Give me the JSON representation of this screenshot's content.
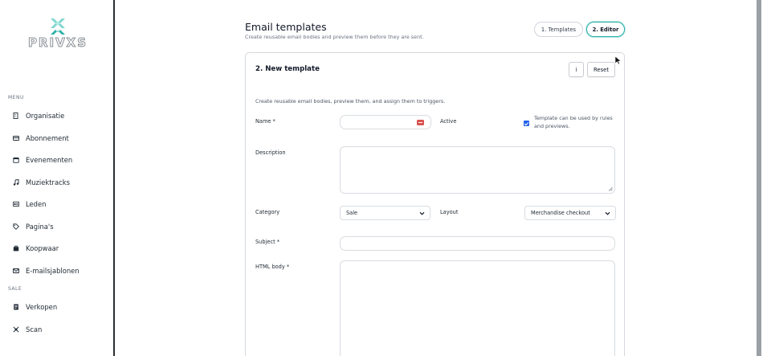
{
  "brand": {
    "logo_text": "PRIVXS",
    "accent": "#2bb0a8"
  },
  "sidebar": {
    "menu_label": "MENU",
    "items": [
      {
        "label": "Organisatie",
        "icon": "building-icon"
      },
      {
        "label": "Abonnement",
        "icon": "card-icon"
      },
      {
        "label": "Evenementen",
        "icon": "calendar-icon"
      },
      {
        "label": "Muziektracks",
        "icon": "music-note-icon"
      },
      {
        "label": "Leden",
        "icon": "id-card-icon"
      },
      {
        "label": "Pagina's",
        "icon": "tag-icon"
      },
      {
        "label": "Koopwaar",
        "icon": "bag-icon"
      },
      {
        "label": "E-mailsjablonen",
        "icon": "mail-template-icon"
      }
    ],
    "sale_label": "SALE",
    "sale_items": [
      {
        "label": "Verkopen",
        "icon": "receipt-icon"
      },
      {
        "label": "Scan",
        "icon": "scan-icon"
      }
    ]
  },
  "header": {
    "title": "Email templates",
    "subtitle": "Create reusable email bodies and preview them before they are sent.",
    "steps": [
      {
        "label": "1. Templates",
        "active": false
      },
      {
        "label": "2. Editor",
        "active": true
      }
    ]
  },
  "card": {
    "title": "2. New template",
    "info_label": "i",
    "reset_label": "Reset",
    "description": "Create reusable email bodies, preview them, and assign them to triggers.",
    "form": {
      "name_label": "Name *",
      "name_value": "",
      "active_label": "Active",
      "active_checked": true,
      "active_hint": "Template can be used by rules and previews.",
      "description_label": "Description",
      "description_value": "",
      "category_label": "Category",
      "category_value": "Sale",
      "layout_label": "Layout",
      "layout_value": "Merchandise checkout",
      "subject_label": "Subject *",
      "subject_value": "",
      "html_body_label": "HTML body *",
      "html_body_value": ""
    }
  }
}
